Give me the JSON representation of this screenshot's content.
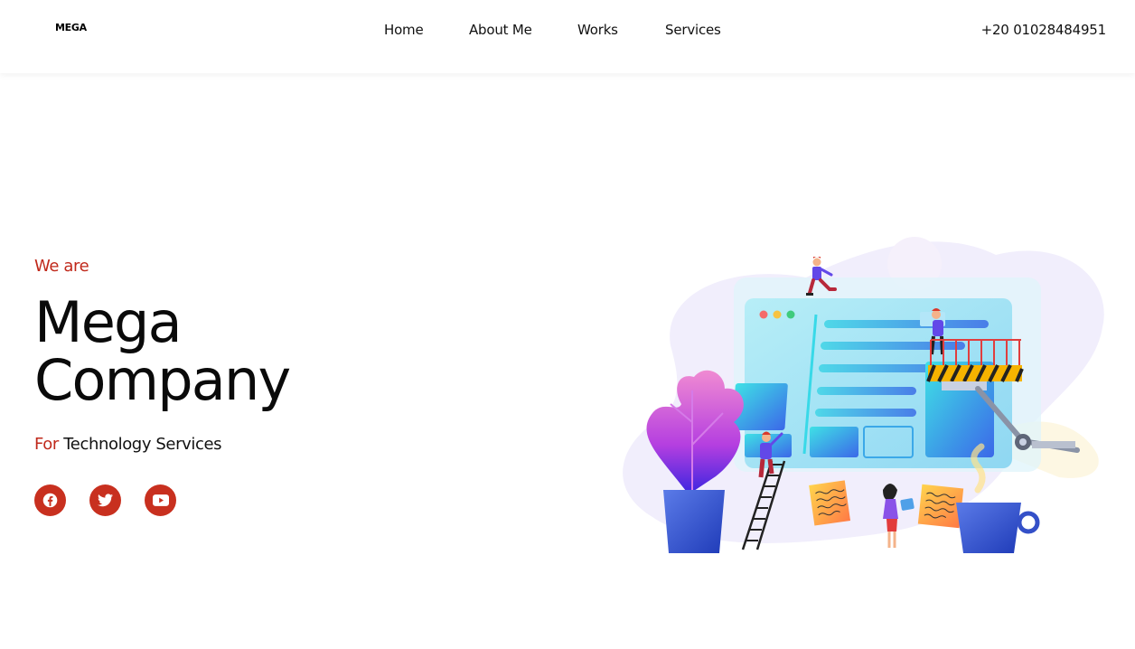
{
  "header": {
    "logo_text": "MEGA",
    "nav": [
      {
        "label": "Home"
      },
      {
        "label": "About Me"
      },
      {
        "label": "Works"
      },
      {
        "label": "Services"
      }
    ],
    "phone": "+20 01028484951"
  },
  "hero": {
    "intro": "We are",
    "title": "Mega Company",
    "tagline_prefix": "For",
    "tagline_rest": " Technology Services"
  },
  "socials": [
    {
      "icon": "facebook-icon"
    },
    {
      "icon": "twitter-icon"
    },
    {
      "icon": "youtube-icon"
    }
  ],
  "colors": {
    "accent": "#c0291b",
    "text": "#111111",
    "background": "#ffffff"
  }
}
